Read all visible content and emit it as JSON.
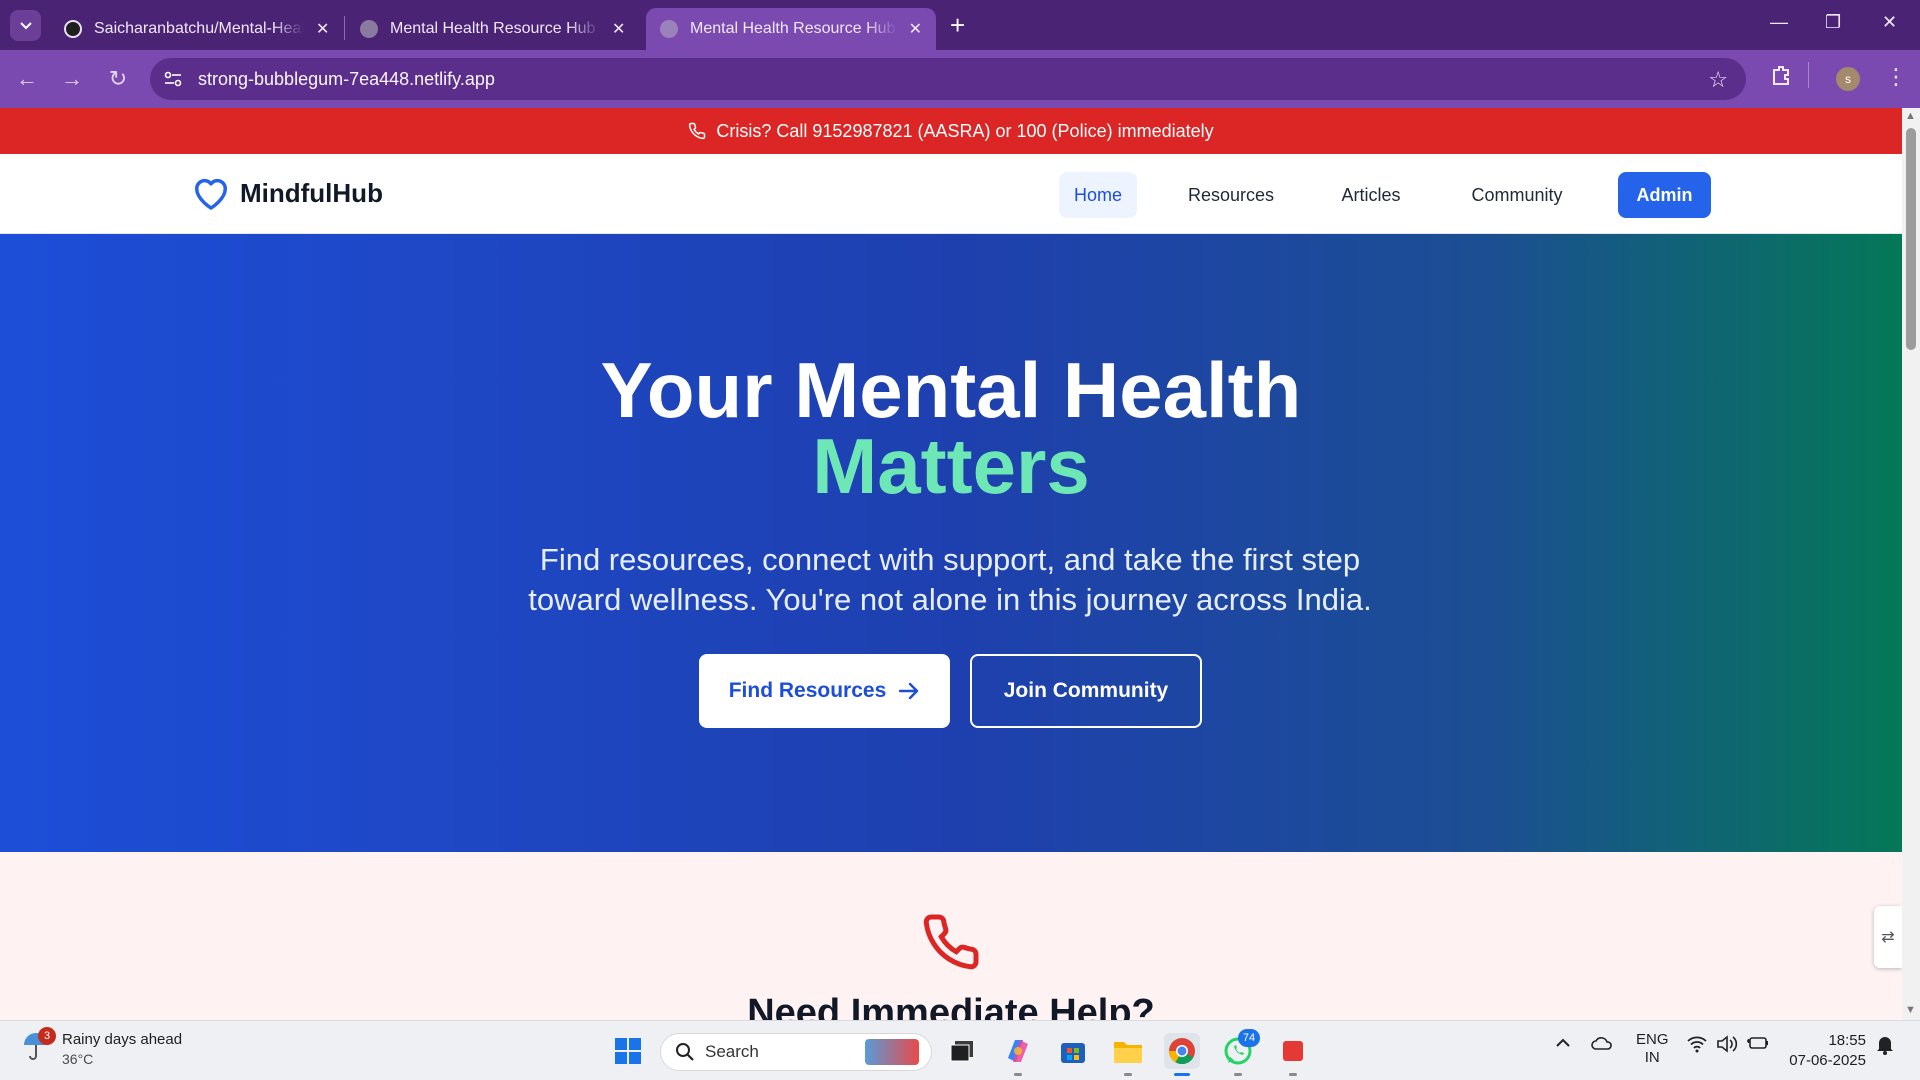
{
  "browser": {
    "tabs": [
      {
        "title": "Saicharanbatchu/Mental-Health-Resource-Hub",
        "active": false
      },
      {
        "title": "Mental Health Resource Hub - S",
        "active": false
      },
      {
        "title": "Mental Health Resource Hub - S",
        "active": true
      }
    ],
    "url": "strong-bubblegum-7ea448.netlify.app",
    "profile_initial": "s"
  },
  "crisis_banner": {
    "text": "Crisis? Call 9152987821 (AASRA) or 100 (Police) immediately"
  },
  "header": {
    "logo_text": "MindfulHub",
    "nav": {
      "home": "Home",
      "resources": "Resources",
      "articles": "Articles",
      "community": "Community",
      "admin": "Admin"
    }
  },
  "hero": {
    "title_line1": "Your Mental Health",
    "title_line2": "Matters",
    "subtitle": "Find resources, connect with support, and take the first step toward wellness. You're not alone in this journey across India.",
    "find_button": "Find Resources",
    "join_button": "Join Community"
  },
  "help_section": {
    "title": "Need Immediate Help?"
  },
  "taskbar": {
    "weather_title": "Rainy days ahead",
    "weather_temp": "36°C",
    "weather_badge": "3",
    "search_label": "Search",
    "whatsapp_badge": "74",
    "lang_top": "ENG",
    "lang_bottom": "IN",
    "time": "18:55",
    "date": "07-06-2025"
  },
  "colors": {
    "crisis": "#dc2626",
    "primary": "#2563eb",
    "accent": "#6ee7b7",
    "browser_frame": "#4a2374"
  }
}
